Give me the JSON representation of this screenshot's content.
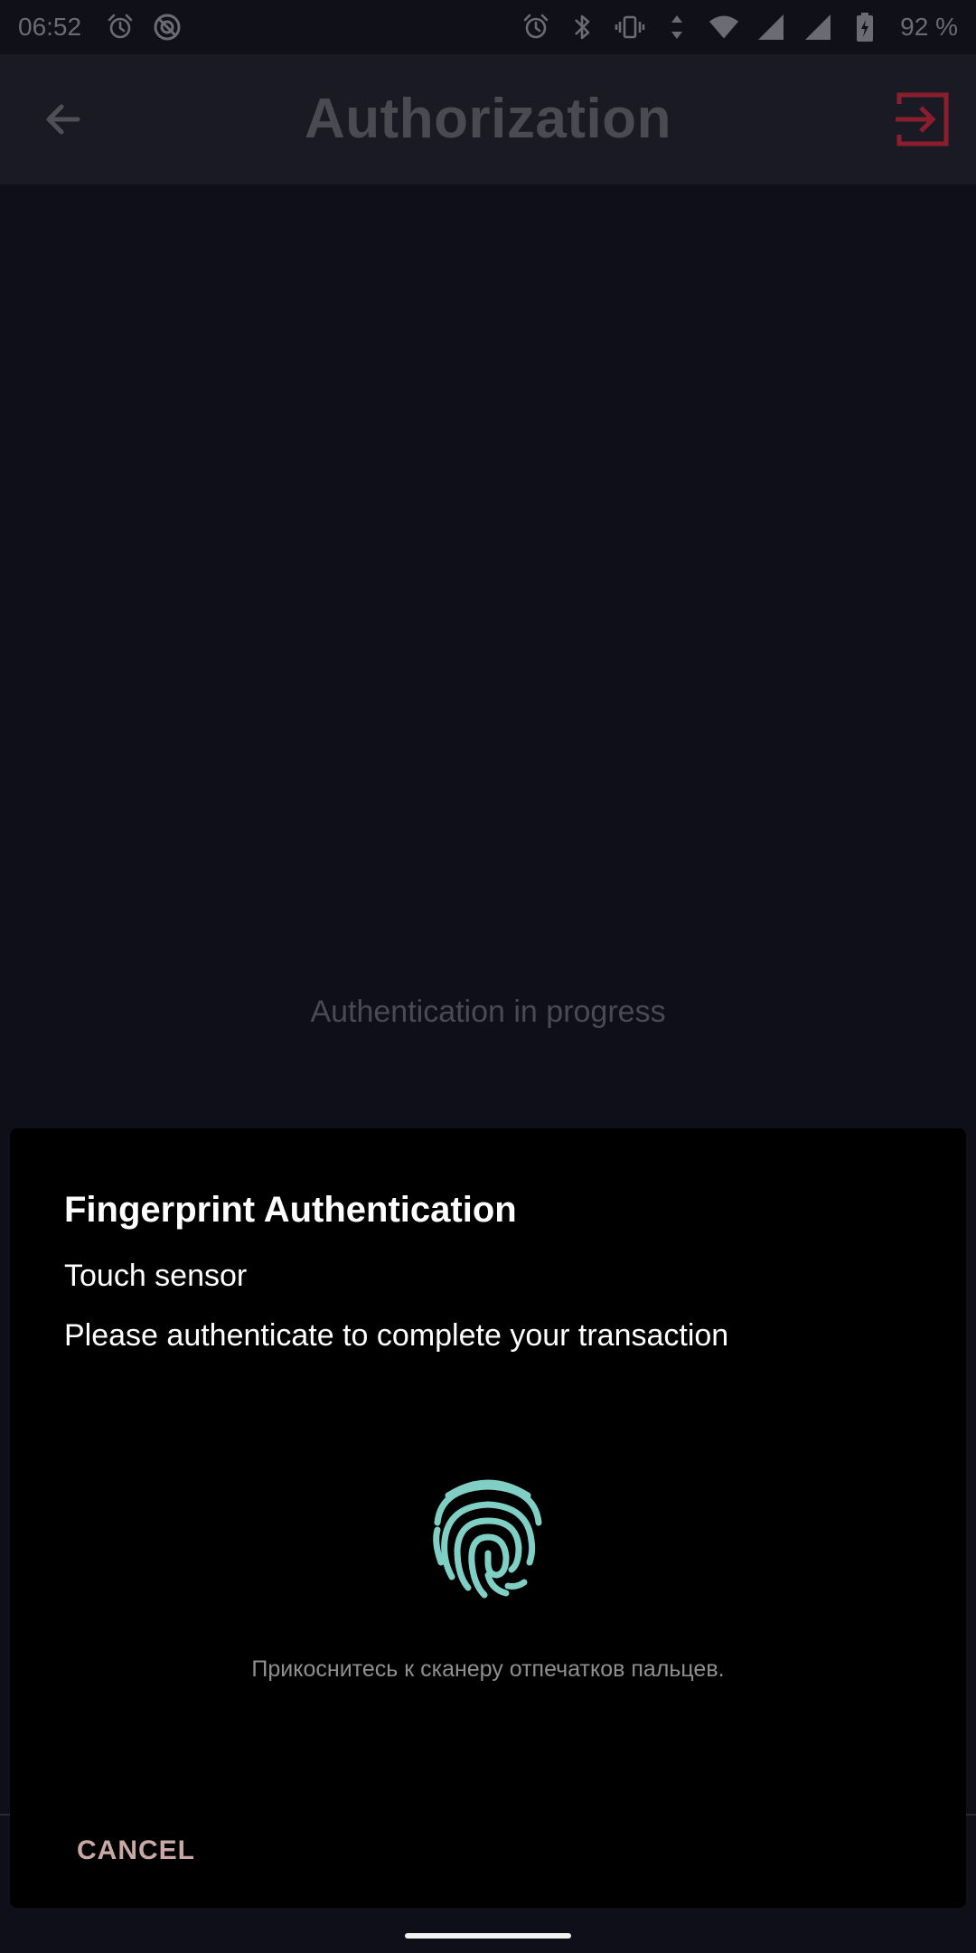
{
  "status_bar": {
    "time": "06:52",
    "battery_level": "92 %",
    "left_icons": [
      "alarm-icon",
      "no-disturb-icon"
    ],
    "right_icons": [
      "alarm-icon",
      "bluetooth-icon",
      "vibrate-icon",
      "data-arrows-icon",
      "wifi-icon",
      "signal-icon",
      "signal-icon",
      "battery-charging-icon"
    ]
  },
  "app_bar": {
    "title": "Authorization",
    "back_icon": "arrow-left-icon",
    "action_icon": "login-icon",
    "action_color": "#8a1e2c"
  },
  "main": {
    "progress_text": "Authentication in progress"
  },
  "dialog": {
    "title": "Fingerprint Authentication",
    "subtitle": "Touch sensor",
    "description": "Please authenticate to complete your transaction",
    "fingerprint_color": "#7fcfc4",
    "hint": "Прикоснитесь к сканеру отпечатков пальцев.",
    "cancel_label": "CANCEL"
  }
}
